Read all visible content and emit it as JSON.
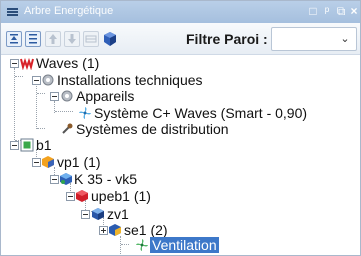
{
  "window": {
    "title": "Arbre Energétique"
  },
  "toolbar": {
    "filter_label": "Filtre Paroi :",
    "filter_value": ""
  },
  "tree": {
    "items": [
      {
        "label": "Waves (1)"
      },
      {
        "label": "Installations techniques"
      },
      {
        "label": "Appareils"
      },
      {
        "label": "Système C+ Waves (Smart - 0,90)"
      },
      {
        "label": "Systèmes de distribution"
      },
      {
        "label": "b1"
      },
      {
        "label": "vp1 (1)"
      },
      {
        "label": "K 35 - vk5"
      },
      {
        "label": "upeb1 (1)"
      },
      {
        "label": "zv1"
      },
      {
        "label": "se1 (2)"
      },
      {
        "label": "Ventilation"
      }
    ]
  },
  "colors": {
    "selection": "#3d78c9",
    "titlebar": "#a5bfde"
  }
}
